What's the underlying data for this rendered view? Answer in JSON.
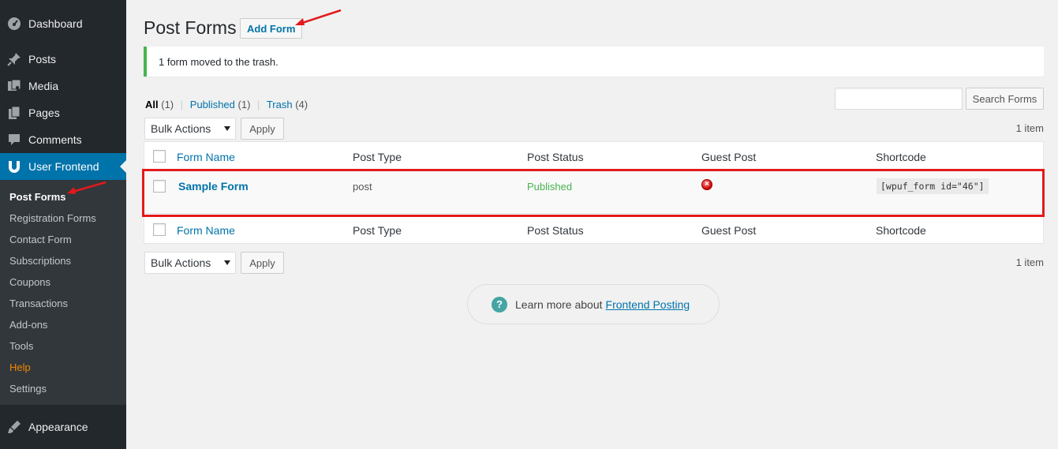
{
  "sidebar": {
    "menu": [
      {
        "label": "Dashboard",
        "icon": "dashboard-icon"
      },
      {
        "label": "Posts",
        "icon": "pushpin-icon"
      },
      {
        "label": "Media",
        "icon": "media-icon"
      },
      {
        "label": "Pages",
        "icon": "pages-icon"
      },
      {
        "label": "Comments",
        "icon": "comment-icon"
      },
      {
        "label": "User Frontend",
        "icon": "wpuf-logo-icon"
      },
      {
        "label": "Appearance",
        "icon": "paintbrush-icon"
      }
    ],
    "submenu": [
      {
        "label": "Post Forms"
      },
      {
        "label": "Registration Forms"
      },
      {
        "label": "Contact Form"
      },
      {
        "label": "Subscriptions"
      },
      {
        "label": "Coupons"
      },
      {
        "label": "Transactions"
      },
      {
        "label": "Add-ons"
      },
      {
        "label": "Tools"
      },
      {
        "label": "Help"
      },
      {
        "label": "Settings"
      }
    ]
  },
  "header": {
    "title": "Post Forms",
    "add_button": "Add Form"
  },
  "notice": "1 form moved to the trash.",
  "filters": {
    "all": "All",
    "all_count": "(1)",
    "published": "Published",
    "published_count": "(1)",
    "trash": "Trash",
    "trash_count": "(4)",
    "separator": "|"
  },
  "search": {
    "placeholder": "",
    "button": "Search Forms"
  },
  "bulk": {
    "select_label": "Bulk Actions",
    "apply": "Apply",
    "item_count": "1 item"
  },
  "table": {
    "columns": [
      "Form Name",
      "Post Type",
      "Post Status",
      "Guest Post",
      "Shortcode"
    ],
    "rows": [
      {
        "form_name": "Sample Form",
        "post_type": "post",
        "post_status": "Published",
        "guest_post_icon": "error-circle-icon",
        "shortcode": "[wpuf_form id=\"46\"]"
      }
    ]
  },
  "learn_more": {
    "text": "Learn more about",
    "link": "Frontend Posting"
  },
  "colors": {
    "accent": "#0073aa",
    "sidebar_bg": "#23282d",
    "notice_border": "#46b450",
    "highlight": "#e3191b",
    "help": "#f18500"
  }
}
